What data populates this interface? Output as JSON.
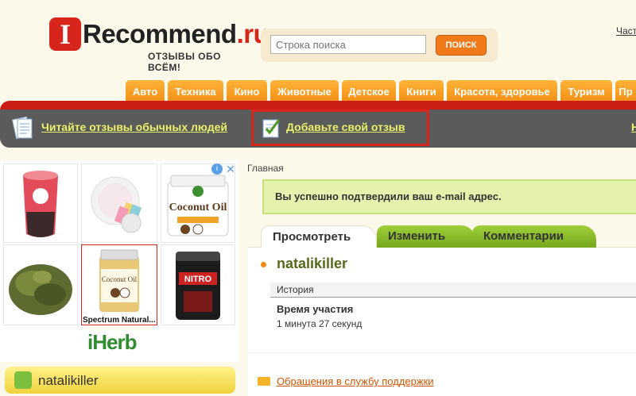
{
  "logo": {
    "letter": "I",
    "name": "Recommend",
    "domain": ".ru",
    "tagline": "ОТЗЫВЫ ОБО ВСЁМ!"
  },
  "search": {
    "placeholder": "Строка поиска",
    "button": "ПОИСК"
  },
  "top_link": "Част",
  "categories": [
    "Авто",
    "Техника",
    "Кино",
    "Животные",
    "Детское",
    "Книги",
    "Красота, здоровье",
    "Туризм",
    "Пр"
  ],
  "nav": {
    "read": "Читайте отзывы обычных людей",
    "add": "Добавьте свой отзыв",
    "right": "Н"
  },
  "ads": {
    "caption": "Spectrum Natural...",
    "brand": "iHerb",
    "info": "i",
    "close": "✕"
  },
  "left_user": {
    "name": "natalikiller"
  },
  "breadcrumb": "Главная",
  "notice": "Вы успешно подтвердили ваш e-mail адрес.",
  "tabs": {
    "view": "Просмотреть",
    "edit": "Изменить",
    "comments": "Комментарии"
  },
  "profile": {
    "username": "natalikiller",
    "section": "История",
    "field_label": "Время участия",
    "field_value": "1 минута 27 секунд"
  },
  "support": "Обращения в службу поддержки",
  "colors": {
    "accent": "#f28b12",
    "red": "#cc1c16",
    "nav_gray": "#5b5b5b",
    "green": "#76a71d",
    "link_yellow": "#e9f06a"
  }
}
